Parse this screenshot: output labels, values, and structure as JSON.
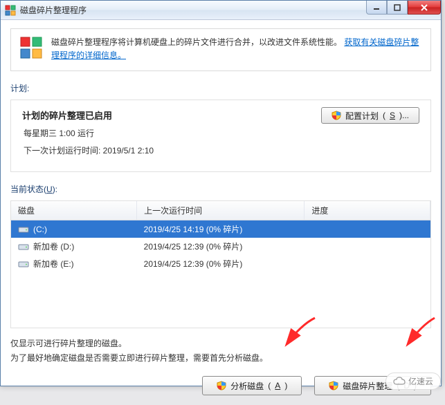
{
  "window": {
    "title": "磁盘碎片整理程序"
  },
  "info": {
    "text": "磁盘碎片整理程序将计算机硬盘上的碎片文件进行合并，以改进文件系统性能。",
    "link": "获取有关磁盘碎片整理程序的详细信息。"
  },
  "schedule": {
    "label": "计划:",
    "title": "计划的碎片整理已启用",
    "line1": "每星期三  1:00 运行",
    "line2_prefix": "下一次计划运行时间: ",
    "line2_value": "2019/5/1 2:10",
    "config_btn_label": "配置计划",
    "config_btn_access": "S"
  },
  "status": {
    "label_prefix": "当前状态",
    "label_access": "U",
    "headers": {
      "disk": "磁盘",
      "last_run": "上一次运行时间",
      "progress": "进度"
    },
    "rows": [
      {
        "name": "(C:)",
        "last_run": "2019/4/25 14:19 (0% 碎片)",
        "progress": "",
        "selected": true
      },
      {
        "name": "新加卷 (D:)",
        "last_run": "2019/4/25 12:39 (0% 碎片)",
        "progress": "",
        "selected": false
      },
      {
        "name": "新加卷 (E:)",
        "last_run": "2019/4/25 12:39 (0% 碎片)",
        "progress": "",
        "selected": false
      }
    ]
  },
  "notes": {
    "line1": "仅显示可进行碎片整理的磁盘。",
    "line2": "为了最好地确定磁盘是否需要立即进行碎片整理，需要首先分析磁盘。"
  },
  "actions": {
    "analyze_label": "分析磁盘",
    "analyze_access": "A",
    "defrag_label": "磁盘碎片整理",
    "defrag_access": "D"
  },
  "watermark": "亿速云",
  "colors": {
    "accent": "#2f77d1",
    "link": "#0066cc",
    "arrow": "#ff2a2a"
  }
}
